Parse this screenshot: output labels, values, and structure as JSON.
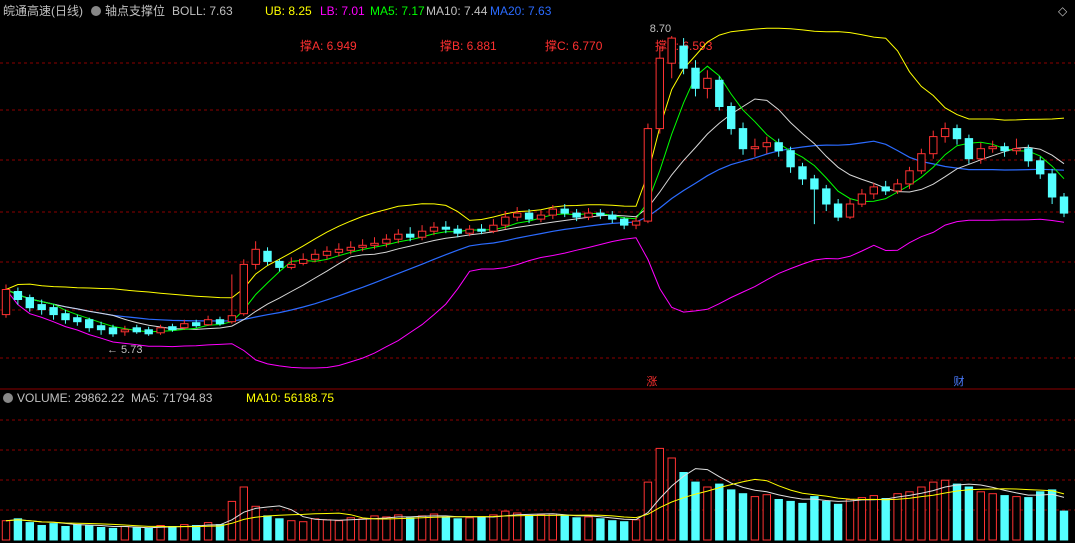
{
  "header": {
    "stock_name": "皖通高速(日线)",
    "indicator_name": "轴点支撑位",
    "items": [
      {
        "label": "BOLL: 7.63",
        "color": "#c0c0c0"
      },
      {
        "label": "UB: 8.25",
        "color": "#ffff00"
      },
      {
        "label": "LB: 7.01",
        "color": "#ff00ff"
      },
      {
        "label": "MA5: 7.17",
        "color": "#00ff00"
      },
      {
        "label": "MA10: 7.44",
        "color": "#c0c0c0"
      },
      {
        "label": "MA20: 7.63",
        "color": "#2b6bff"
      }
    ]
  },
  "support_labels": [
    {
      "label": "撑A:",
      "value": "6.949"
    },
    {
      "label": "撑B:",
      "value": "6.881"
    },
    {
      "label": "撑C:",
      "value": "6.770"
    },
    {
      "label": "撑D:",
      "value": "6.593"
    }
  ],
  "annotations": {
    "low_label": "5.73",
    "high_label": "8.70"
  },
  "markers": [
    {
      "text": "涨",
      "color": "#ff3030"
    },
    {
      "text": "财",
      "color": "#4a7bff"
    }
  ],
  "volume_header": {
    "items": [
      {
        "label": "VOLUME: 29862.22",
        "color": "#c0c0c0"
      },
      {
        "label": "MA5: 71794.83",
        "color": "#c0c0c0"
      },
      {
        "label": "MA10: 56188.75",
        "color": "#ffff00"
      }
    ]
  },
  "colors": {
    "up": "#ff3232",
    "down": "#54ffff",
    "grid": "#8b0000",
    "ma5": "#00ff00",
    "ma10": "#d8d8d8",
    "ma20": "#2b6bff",
    "ub": "#ffff00",
    "lb": "#ff00ff",
    "vol_ma5": "#e0e0e0",
    "vol_ma10": "#ffff00"
  },
  "chart_data": {
    "type": "candlestick",
    "title": "皖通高速(日线)",
    "ylim": [
      5.4,
      8.8
    ],
    "candles": [
      [
        5.95,
        6.2,
        6.25,
        5.92
      ],
      [
        6.18,
        6.1,
        6.22,
        6.05
      ],
      [
        6.12,
        6.02,
        6.15,
        5.98
      ],
      [
        6.05,
        6.0,
        6.1,
        5.95
      ],
      [
        6.02,
        5.95,
        6.05,
        5.9
      ],
      [
        5.96,
        5.9,
        6.0,
        5.86
      ],
      [
        5.92,
        5.88,
        5.95,
        5.84
      ],
      [
        5.9,
        5.82,
        5.92,
        5.78
      ],
      [
        5.84,
        5.8,
        5.88,
        5.75
      ],
      [
        5.82,
        5.76,
        5.85,
        5.73
      ],
      [
        5.78,
        5.8,
        5.84,
        5.74
      ],
      [
        5.82,
        5.78,
        5.85,
        5.76
      ],
      [
        5.8,
        5.76,
        5.83,
        5.74
      ],
      [
        5.77,
        5.82,
        5.85,
        5.75
      ],
      [
        5.83,
        5.8,
        5.86,
        5.78
      ],
      [
        5.82,
        5.86,
        5.9,
        5.8
      ],
      [
        5.87,
        5.84,
        5.9,
        5.82
      ],
      [
        5.85,
        5.9,
        5.94,
        5.84
      ],
      [
        5.9,
        5.86,
        5.93,
        5.84
      ],
      [
        5.88,
        5.94,
        6.35,
        5.86
      ],
      [
        5.96,
        6.45,
        6.5,
        5.94
      ],
      [
        6.45,
        6.6,
        6.68,
        6.4
      ],
      [
        6.58,
        6.48,
        6.62,
        6.44
      ],
      [
        6.48,
        6.42,
        6.5,
        6.38
      ],
      [
        6.42,
        6.45,
        6.52,
        6.4
      ],
      [
        6.46,
        6.5,
        6.56,
        6.44
      ],
      [
        6.5,
        6.55,
        6.6,
        6.47
      ],
      [
        6.54,
        6.58,
        6.63,
        6.5
      ],
      [
        6.57,
        6.6,
        6.66,
        6.53
      ],
      [
        6.59,
        6.62,
        6.68,
        6.55
      ],
      [
        6.62,
        6.64,
        6.7,
        6.58
      ],
      [
        6.64,
        6.66,
        6.72,
        6.6
      ],
      [
        6.66,
        6.7,
        6.75,
        6.62
      ],
      [
        6.7,
        6.75,
        6.8,
        6.66
      ],
      [
        6.75,
        6.72,
        6.82,
        6.68
      ],
      [
        6.72,
        6.78,
        6.84,
        6.69
      ],
      [
        6.78,
        6.82,
        6.87,
        6.74
      ],
      [
        6.82,
        6.8,
        6.88,
        6.76
      ],
      [
        6.8,
        6.76,
        6.84,
        6.72
      ],
      [
        6.76,
        6.8,
        6.84,
        6.73
      ],
      [
        6.8,
        6.78,
        6.85,
        6.75
      ],
      [
        6.78,
        6.84,
        6.9,
        6.76
      ],
      [
        6.84,
        6.92,
        6.98,
        6.8
      ],
      [
        6.92,
        6.96,
        7.02,
        6.88
      ],
      [
        6.96,
        6.9,
        7.0,
        6.86
      ],
      [
        6.9,
        6.94,
        6.99,
        6.87
      ],
      [
        6.94,
        7.0,
        7.04,
        6.9
      ],
      [
        7.0,
        6.96,
        7.05,
        6.92
      ],
      [
        6.96,
        6.92,
        7.0,
        6.88
      ],
      [
        6.92,
        6.96,
        7.01,
        6.89
      ],
      [
        6.96,
        6.94,
        7.0,
        6.9
      ],
      [
        6.94,
        6.9,
        6.98,
        6.86
      ],
      [
        6.9,
        6.84,
        6.92,
        6.8
      ],
      [
        6.84,
        6.88,
        6.92,
        6.8
      ],
      [
        6.88,
        7.8,
        7.85,
        6.86
      ],
      [
        7.8,
        8.5,
        8.62,
        7.75
      ],
      [
        8.45,
        8.7,
        8.72,
        8.3
      ],
      [
        8.62,
        8.4,
        8.7,
        8.34
      ],
      [
        8.4,
        8.2,
        8.48,
        8.12
      ],
      [
        8.2,
        8.3,
        8.38,
        8.1
      ],
      [
        8.28,
        8.02,
        8.32,
        7.98
      ],
      [
        8.02,
        7.8,
        8.06,
        7.74
      ],
      [
        7.8,
        7.6,
        7.86,
        7.54
      ],
      [
        7.6,
        7.62,
        7.7,
        7.52
      ],
      [
        7.62,
        7.66,
        7.72,
        7.55
      ],
      [
        7.66,
        7.58,
        7.7,
        7.52
      ],
      [
        7.58,
        7.42,
        7.62,
        7.36
      ],
      [
        7.42,
        7.3,
        7.46,
        7.24
      ],
      [
        7.3,
        7.2,
        7.34,
        6.85
      ],
      [
        7.2,
        7.05,
        7.24,
        6.98
      ],
      [
        7.05,
        6.92,
        7.1,
        6.88
      ],
      [
        6.92,
        7.05,
        7.1,
        6.9
      ],
      [
        7.05,
        7.15,
        7.2,
        7.02
      ],
      [
        7.15,
        7.22,
        7.26,
        7.1
      ],
      [
        7.22,
        7.18,
        7.28,
        7.14
      ],
      [
        7.18,
        7.25,
        7.3,
        7.15
      ],
      [
        7.25,
        7.38,
        7.42,
        7.2
      ],
      [
        7.38,
        7.55,
        7.6,
        7.35
      ],
      [
        7.55,
        7.72,
        7.78,
        7.5
      ],
      [
        7.72,
        7.8,
        7.86,
        7.66
      ],
      [
        7.8,
        7.7,
        7.84,
        7.64
      ],
      [
        7.7,
        7.5,
        7.74,
        7.45
      ],
      [
        7.5,
        7.6,
        7.66,
        7.45
      ],
      [
        7.6,
        7.62,
        7.68,
        7.56
      ],
      [
        7.62,
        7.58,
        7.66,
        7.52
      ],
      [
        7.58,
        7.6,
        7.7,
        7.54
      ],
      [
        7.6,
        7.48,
        7.64,
        7.42
      ],
      [
        7.48,
        7.35,
        7.52,
        7.3
      ],
      [
        7.35,
        7.12,
        7.4,
        7.05
      ],
      [
        7.12,
        6.96,
        7.16,
        6.92
      ]
    ],
    "volume": [
      20,
      22,
      18,
      15,
      17,
      14,
      16,
      15,
      13,
      12,
      14,
      13,
      12,
      15,
      14,
      16,
      15,
      18,
      16,
      40,
      55,
      35,
      25,
      22,
      20,
      19,
      22,
      21,
      20,
      23,
      22,
      25,
      24,
      26,
      23,
      25,
      27,
      24,
      22,
      23,
      24,
      26,
      30,
      28,
      25,
      26,
      27,
      25,
      23,
      24,
      22,
      20,
      19,
      21,
      60,
      95,
      85,
      70,
      60,
      55,
      58,
      52,
      48,
      45,
      47,
      42,
      40,
      38,
      45,
      40,
      37,
      42,
      44,
      46,
      43,
      48,
      50,
      55,
      60,
      62,
      58,
      55,
      50,
      48,
      46,
      45,
      44,
      50,
      52,
      30
    ],
    "volume_ylim": [
      0,
      140
    ]
  }
}
